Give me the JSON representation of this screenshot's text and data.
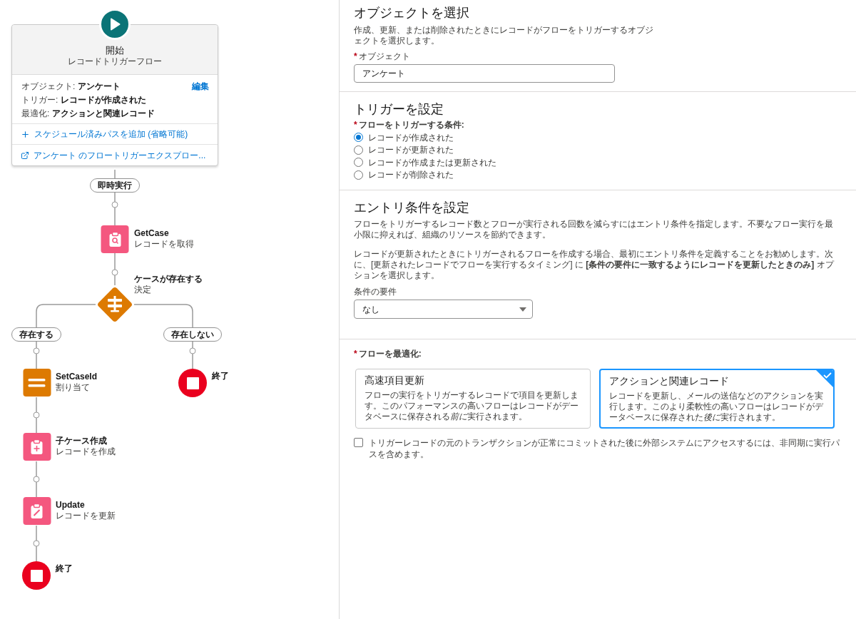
{
  "flow": {
    "start": {
      "title": "開始",
      "subtitle": "レコードトリガーフロー",
      "edit_link": "編集",
      "details": [
        {
          "label": "オブジェクト:",
          "value": "アンケート"
        },
        {
          "label": "トリガー:",
          "value": "レコードが作成された"
        },
        {
          "label": "最適化:",
          "value": "アクションと関連レコード"
        }
      ],
      "links": [
        {
          "kind": "add",
          "text": "スケジュール済みパスを追加 (省略可能)"
        },
        {
          "kind": "external",
          "text": "アンケート のフロートリガーエクスプロー..."
        }
      ]
    },
    "path_label": "即時実行",
    "nodes": [
      {
        "kind": "get",
        "title": "GetCase",
        "subtitle": "レコードを取得"
      },
      {
        "kind": "decision",
        "title": "ケースが存在する",
        "subtitle": "決定"
      }
    ],
    "branches": [
      {
        "label": "存在する",
        "nodes": [
          {
            "kind": "assign",
            "title": "SetCaseId",
            "subtitle": "割り当て"
          },
          {
            "kind": "create",
            "title": "子ケース作成",
            "subtitle": "レコードを作成"
          },
          {
            "kind": "update",
            "title": "Update",
            "subtitle": "レコードを更新"
          },
          {
            "kind": "end",
            "title": "終了"
          }
        ]
      },
      {
        "label": "存在しない",
        "nodes": [
          {
            "kind": "end",
            "title": "終了"
          }
        ]
      }
    ]
  },
  "object_section": {
    "title": "オブジェクトを選択",
    "description": "作成、更新、または削除されたときにレコードがフローをトリガーするオブジェクトを選択します。",
    "field": {
      "required_mark": "*",
      "label": "オブジェクト",
      "value": "アンケート"
    }
  },
  "trigger_section": {
    "title": "トリガーを設定",
    "required_mark": "*",
    "label": "フローをトリガーする条件:",
    "options": [
      {
        "label": "レコードが作成された",
        "selected": true
      },
      {
        "label": "レコードが更新された",
        "selected": false
      },
      {
        "label": "レコードが作成または更新された",
        "selected": false
      },
      {
        "label": "レコードが削除された",
        "selected": false
      }
    ]
  },
  "entry_section": {
    "title": "エントリ条件を設定",
    "paragraphs": [
      "フローをトリガーするレコード数とフローが実行される回数を減らすにはエントリ条件を指定します。不要なフロー実行を最小限に抑えれば、組織のリソースを節約できます。",
      "レコードが更新されたときにトリガーされるフローを作成する場合、最初にエントリ条件を定義することをお勧めします。次に、[更新されたレコードでフローを実行するタイミング] に **[条件の要件に一致するようにレコードを更新したときのみ]** オプションを選択します。"
    ],
    "select": {
      "label": "条件の要件",
      "value": "なし"
    }
  },
  "optimize_section": {
    "required_mark": "*",
    "label": "フローを最適化:",
    "options": [
      {
        "title": "高速項目更新",
        "description": {
          "before": "フローの実行をトリガーするレコードで項目を更新します。このパフォーマンスの高いフローはレコードがデータベースに保存される",
          "emphasis": "前に",
          "after": "実行されます。"
        },
        "selected": false
      },
      {
        "title": "アクションと関連レコード",
        "description": {
          "before": "レコードを更新し、メールの送信などのアクションを実行します。このより柔軟性の高いフローはレコードがデータベースに保存された",
          "emphasis": "後に",
          "after": "実行されます。"
        },
        "selected": true
      }
    ],
    "checkbox": {
      "label": "トリガーレコードの元のトランザクションが正常にコミットされた後に外部システムにアクセスするには、非同期に実行パスを含めます。",
      "checked": false
    }
  }
}
